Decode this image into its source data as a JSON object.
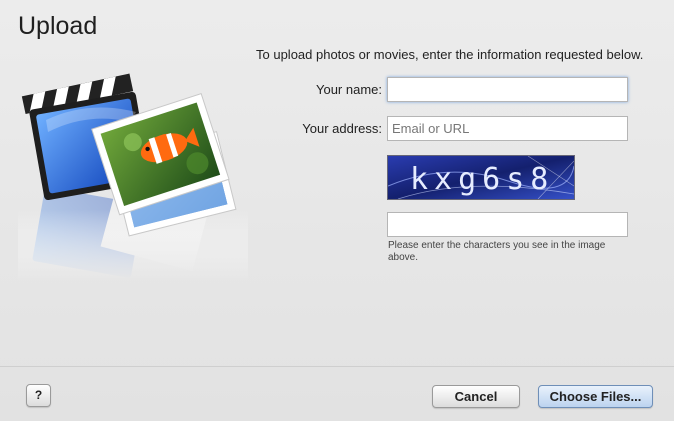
{
  "window": {
    "title": "Upload"
  },
  "intro_text": "To upload photos or movies, enter the information requested below.",
  "form": {
    "name_label": "Your name:",
    "name_value": "",
    "address_label": "Your address:",
    "address_placeholder": "Email or URL",
    "captcha_text": "kxg6s8",
    "captcha_value": "",
    "captcha_hint": "Please enter the characters you see in the image above."
  },
  "footer": {
    "help_label": "?",
    "cancel_label": "Cancel",
    "choose_label": "Choose Files..."
  },
  "colors": {
    "focus_ring": "#8db3e6",
    "default_button": "#bcd3ef",
    "captcha_bg": "#1b2a8e"
  },
  "icons": [
    "clapperboard-icon",
    "photo-clownfish-icon",
    "photo-wave-icon"
  ]
}
